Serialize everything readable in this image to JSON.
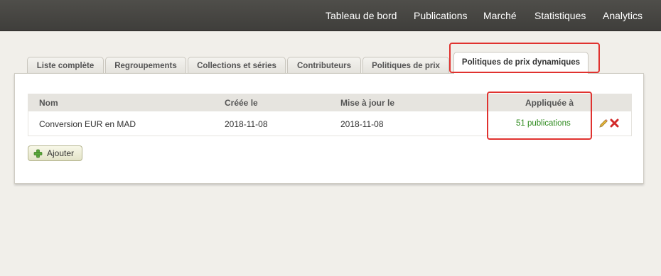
{
  "topnav": {
    "items": [
      "Tableau de bord",
      "Publications",
      "Marché",
      "Statistiques",
      "Analytics"
    ]
  },
  "tabs": {
    "items": [
      "Liste complète",
      "Regroupements",
      "Collections et séries",
      "Contributeurs",
      "Politiques de prix"
    ],
    "active": "Politiques de prix dynamiques"
  },
  "table": {
    "headers": [
      "Nom",
      "Créée le",
      "Mise à jour le",
      "Appliquée à"
    ],
    "rows": [
      {
        "name": "Conversion EUR en MAD",
        "created": "2018-11-08",
        "updated": "2018-11-08",
        "applied": "51 publications",
        "actions": [
          "pencil-icon",
          "delete-icon"
        ]
      }
    ]
  },
  "add_button": {
    "label": "Ajouter",
    "icon": "plus-icon"
  },
  "colors": {
    "nav_bg": "#454440",
    "link_green": "#2e8b1e",
    "highlight_red": "#e0322f",
    "page_bg": "#f1efea"
  }
}
